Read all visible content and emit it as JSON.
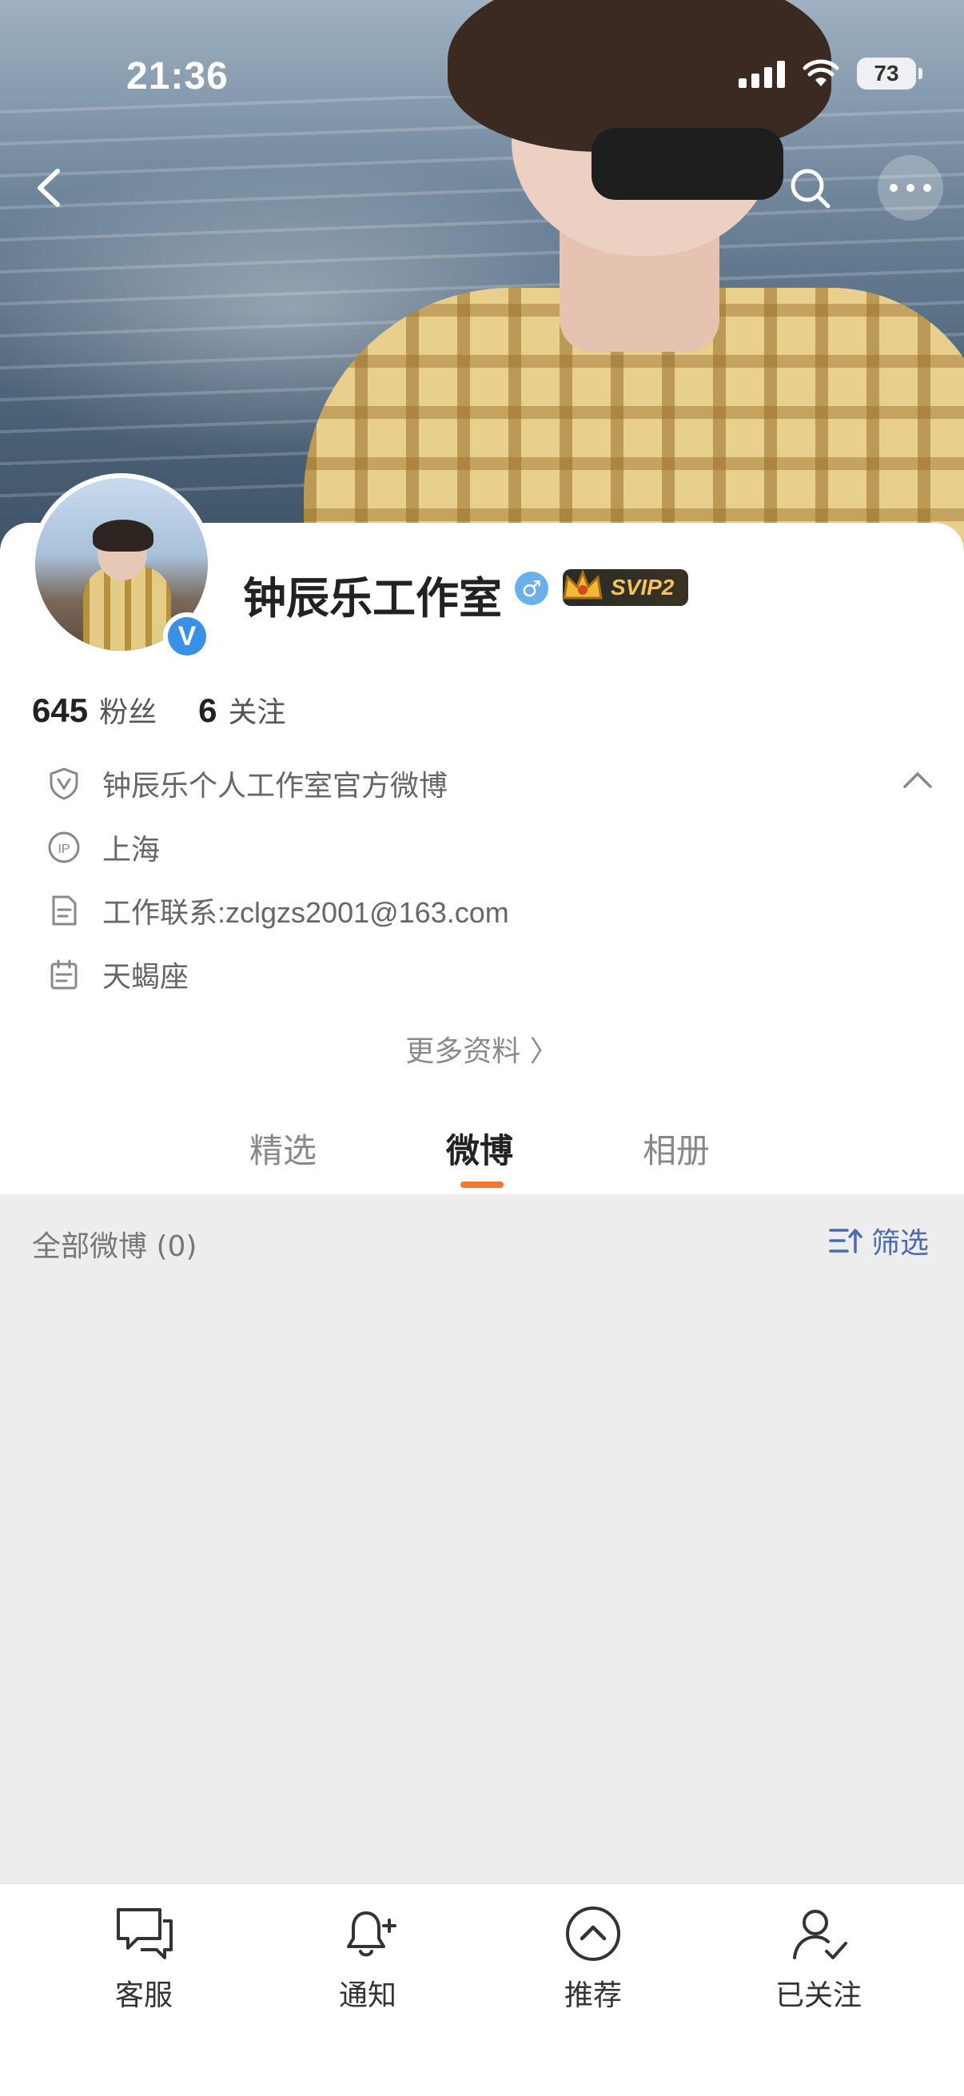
{
  "status_bar": {
    "time": "21:36",
    "battery": "73"
  },
  "profile": {
    "name": "钟辰乐工作室",
    "vip": "SVIP2",
    "followers_count": "645",
    "followers_label": "粉丝",
    "following_count": "6",
    "following_label": "关注"
  },
  "info": {
    "verification": "钟辰乐个人工作室官方微博",
    "ip_location": "上海",
    "contact": "工作联系:zclgzs2001@163.com",
    "zodiac": "天蝎座",
    "more_info": "更多资料 〉"
  },
  "tabs": [
    {
      "label": "精选"
    },
    {
      "label": "微博"
    },
    {
      "label": "相册"
    }
  ],
  "feed": {
    "count_label": "全部微博 (0)",
    "filter_label": "筛选"
  },
  "bottom_bar": {
    "service": "客服",
    "notify": "通知",
    "recommend": "推荐",
    "followed": "已关注"
  },
  "colors": {
    "accent": "#f0772e",
    "verified": "#3a8fe6",
    "filter": "#4a6bb0"
  }
}
